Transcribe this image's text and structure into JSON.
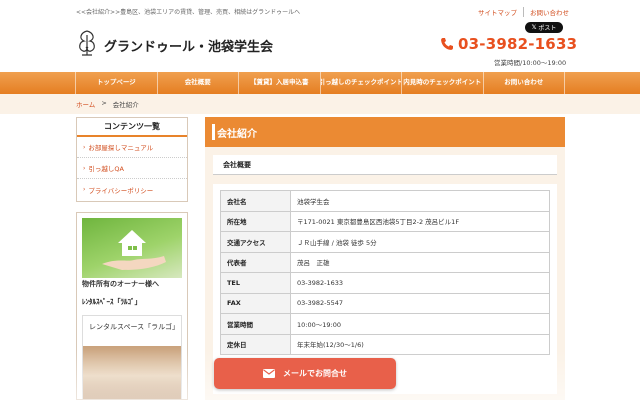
{
  "header": {
    "tagline": "<<会社紹介>>豊島区、池袋エリアの賃貸、管理、売買、相続はグランドゥールへ",
    "links": [
      "サイトマップ",
      "お問い合わせ"
    ],
    "post_label": "ポスト",
    "logo_text": "グランドゥール・池袋学生会",
    "phone": "03-3982-1633",
    "hours": "営業時間/10:00〜19:00"
  },
  "nav": {
    "items": [
      "トップページ",
      "会社概要",
      "【賃貸】入居申込書",
      "引っ越しのチェックポイント",
      "内見時のチェックポイント",
      "お問い合わせ"
    ]
  },
  "breadcrumb": {
    "home": "ホーム",
    "sep": ">",
    "current": "会社紹介"
  },
  "sidebar": {
    "title": "コンテンツ一覧",
    "items": [
      "お部屋探しマニュアル",
      "引っ越しQA",
      "プライバシーポリシー"
    ],
    "banner_caption": "物件所有のオーナー様へ",
    "banner2_title": "ﾚﾝﾀﾙｽﾍﾟｰｽ「ﾗﾙｺﾞ」",
    "banner2_label": "レンタルスペース「ラルゴ」"
  },
  "main": {
    "title": "会社紹介",
    "section_title": "会社概要",
    "rows": [
      {
        "key": "会社名",
        "value": "池袋学生会"
      },
      {
        "key": "所在地",
        "value": "〒171-0021 東京都豊島区西池袋5丁目2-2 茂呂ビル1F"
      },
      {
        "key": "交通アクセス",
        "value": "ＪＲ山手線 / 池袋 徒歩 5分"
      },
      {
        "key": "代表者",
        "value": "茂呂　正雄"
      },
      {
        "key": "TEL",
        "value": "03-3982-1633"
      },
      {
        "key": "FAX",
        "value": "03-3982-5547"
      },
      {
        "key": "営業時間",
        "value": "10:00〜19:00"
      },
      {
        "key": "定休日",
        "value": "年末年始(12/30〜1/6)"
      }
    ]
  },
  "mail_button": {
    "label": "メールでお問合せ"
  },
  "colors": {
    "accent": "#eb8a33",
    "link": "#d24e1f",
    "phone": "#e8501f",
    "mail_button": "#e8604a"
  }
}
